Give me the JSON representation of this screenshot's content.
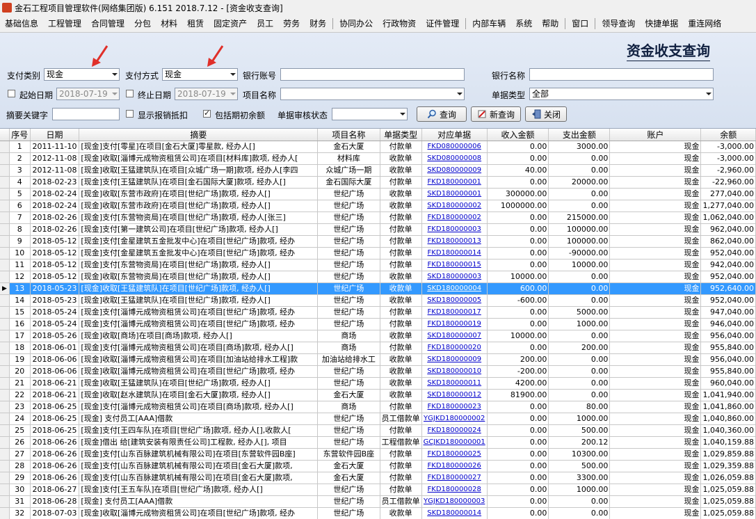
{
  "window": {
    "title": "金石工程项目管理软件(网络集团版) 6.151  2018.7.12 - [资金收支查询]"
  },
  "menu": [
    "基础信息",
    "工程管理",
    "合同管理",
    "分包",
    "材料",
    "租赁",
    "固定资产",
    "员工",
    "劳务",
    "财务",
    "协同办公",
    "行政物资",
    "证件管理",
    "内部车辆",
    "系统",
    "帮助",
    "窗口",
    "领导查询",
    "快捷单据",
    "重连网络"
  ],
  "page": {
    "title": "资金收支查询"
  },
  "filters": {
    "pay_category_label": "支付类别",
    "pay_category_value": "现金",
    "pay_method_label": "支付方式",
    "pay_method_value": "现金",
    "bank_account_label": "银行账号",
    "bank_account_value": "",
    "bank_name_label": "银行名称",
    "bank_name_value": "",
    "start_date_label": "起始日期",
    "start_date_value": "2018-07-19",
    "end_date_label": "终止日期",
    "end_date_value": "2018-07-19",
    "project_name_label": "项目名称",
    "project_name_value": "",
    "doc_type_label": "单据类型",
    "doc_type_value": "全部",
    "keyword_label": "摘要关键字",
    "keyword_value": "",
    "show_reimburse_label": "显示报销抵扣",
    "include_opening_label": "包括期初余额",
    "audit_status_label": "单据审核状态",
    "audit_status_value": ""
  },
  "buttons": {
    "query": "查询",
    "new_query": "新查询",
    "close": "关闭"
  },
  "colors": {
    "accent": "#3399ff",
    "link": "#0000cc",
    "arrow": "#e0302a"
  },
  "table": {
    "headers": [
      "序号",
      "日期",
      "摘要",
      "项目名称",
      "单据类型",
      "对应单据",
      "收入金额",
      "支出金额",
      "账户",
      "余额"
    ],
    "selected_row": 12,
    "rows": [
      [
        "1",
        "2011-11-10",
        "[现金]支付[零星]在项目[金石大厦]零星款, 经办人[]",
        "金石大厦",
        "付款单",
        "FKD080000006",
        "0.00",
        "3000.00",
        "现金",
        "-3,000.00"
      ],
      [
        "2",
        "2012-11-08",
        "[现金]收取[淄博元成物资租赁公司]在项目[材料库]款项, 经办人[",
        "材料库",
        "收款单",
        "SKD080000008",
        "0.00",
        "0.00",
        "现金",
        "-3,000.00"
      ],
      [
        "3",
        "2012-11-08",
        "[现金]收取[王猛建筑队]在项目[众城广场一期]款项, 经办人[李四",
        "众城广场一期",
        "收款单",
        "SKD080000009",
        "40.00",
        "0.00",
        "现金",
        "-2,960.00"
      ],
      [
        "4",
        "2018-02-23",
        "[现金]支付[王猛建筑队]在项目[金石国际大厦]款项, 经办人[]",
        "金石国际大厦",
        "付款单",
        "FKD180000001",
        "0.00",
        "20000.00",
        "现金",
        "-22,960.00"
      ],
      [
        "5",
        "2018-02-24",
        "[现金]收取[东营市政府]在项目[世纪广场]款项, 经办人[]",
        "世纪广场",
        "收款单",
        "SKD180000001",
        "300000.00",
        "0.00",
        "现金",
        "277,040.00"
      ],
      [
        "6",
        "2018-02-24",
        "[现金]收取[东营市政府]在项目[世纪广场]款项, 经办人[]",
        "世纪广场",
        "收款单",
        "SKD180000002",
        "1000000.00",
        "0.00",
        "现金",
        "1,277,040.00"
      ],
      [
        "7",
        "2018-02-26",
        "[现金]支付[东营物资局]在项目[世纪广场]款项, 经办人[张三]",
        "世纪广场",
        "付款单",
        "FKD180000002",
        "0.00",
        "215000.00",
        "现金",
        "1,062,040.00"
      ],
      [
        "8",
        "2018-02-26",
        "[现金]支付[第一建筑公司]在项目[世纪广场]款项, 经办人[]",
        "世纪广场",
        "付款单",
        "FKD180000003",
        "0.00",
        "100000.00",
        "现金",
        "962,040.00"
      ],
      [
        "9",
        "2018-05-12",
        "[现金]支付[金星建筑五金批发中心]在项目[世纪广场]款项, 经办",
        "世纪广场",
        "付款单",
        "FKD180000013",
        "0.00",
        "100000.00",
        "现金",
        "862,040.00"
      ],
      [
        "10",
        "2018-05-12",
        "[现金]支付[金星建筑五金批发中心]在项目[世纪广场]款项, 经办",
        "世纪广场",
        "付款单",
        "FKD180000014",
        "0.00",
        "-90000.00",
        "现金",
        "952,040.00"
      ],
      [
        "11",
        "2018-05-12",
        "[现金]支付[东营物资局]在项目[世纪广场]款项, 经办人[]",
        "世纪广场",
        "付款单",
        "FKD180000015",
        "0.00",
        "10000.00",
        "现金",
        "942,040.00"
      ],
      [
        "12",
        "2018-05-12",
        "[现金]收取[东营物资局]在项目[世纪广场]款项, 经办人[]",
        "世纪广场",
        "收款单",
        "SKD180000003",
        "10000.00",
        "0.00",
        "现金",
        "952,040.00"
      ],
      [
        "13",
        "2018-05-23",
        "[现金]收取[王猛建筑队]在项目[世纪广场]款项, 经办人[]",
        "世纪广场",
        "收款单",
        "SKD180000004",
        "600.00",
        "0.00",
        "现金",
        "952,640.00"
      ],
      [
        "14",
        "2018-05-23",
        "[现金]收取[王猛建筑队]在项目[世纪广场]款项, 经办人[]",
        "世纪广场",
        "收款单",
        "SKD180000005",
        "-600.00",
        "0.00",
        "现金",
        "952,040.00"
      ],
      [
        "15",
        "2018-05-24",
        "[现金]支付[淄博元成物资租赁公司]在项目[世纪广场]款项, 经办",
        "世纪广场",
        "付款单",
        "FKD180000017",
        "0.00",
        "5000.00",
        "现金",
        "947,040.00"
      ],
      [
        "16",
        "2018-05-24",
        "[现金]支付[淄博元成物资租赁公司]在项目[世纪广场]款项, 经办",
        "世纪广场",
        "付款单",
        "FKD180000019",
        "0.00",
        "1000.00",
        "现金",
        "946,040.00"
      ],
      [
        "17",
        "2018-05-26",
        "[现金]收取[商场]在项目[商场]款项, 经办人[]",
        "商场",
        "收款单",
        "SKD180000007",
        "10000.00",
        "0.00",
        "现金",
        "956,040.00"
      ],
      [
        "18",
        "2018-06-01",
        "[现金]支付[淄博元成物资租赁公司]在项目[商场]款项, 经办人[]",
        "商场",
        "付款单",
        "FKD180000020",
        "0.00",
        "200.00",
        "现金",
        "955,840.00"
      ],
      [
        "19",
        "2018-06-06",
        "[现金]收取[淄博元成物资租赁公司]在项目[加油站给排水工程]款",
        "加油站给排水工",
        "收款单",
        "SKD180000009",
        "200.00",
        "0.00",
        "现金",
        "956,040.00"
      ],
      [
        "20",
        "2018-06-06",
        "[现金]收取[淄博元成物资租赁公司]在项目[世纪广场]款项, 经办",
        "世纪广场",
        "收款单",
        "SKD180000010",
        "-200.00",
        "0.00",
        "现金",
        "955,840.00"
      ],
      [
        "21",
        "2018-06-21",
        "[现金]收取[王猛建筑队]在项目[世纪广场]款项, 经办人[]",
        "世纪广场",
        "收款单",
        "SKD180000011",
        "4200.00",
        "0.00",
        "现金",
        "960,040.00"
      ],
      [
        "22",
        "2018-06-21",
        "[现金]收取[赵水建筑队]在项目[金石大厦]款项, 经办人[]",
        "金石大厦",
        "收款单",
        "SKD180000012",
        "81900.00",
        "0.00",
        "现金",
        "1,041,940.00"
      ],
      [
        "23",
        "2018-06-25",
        "[现金]支付[淄博元成物资租赁公司]在项目[商场]款项, 经办人[]",
        "商场",
        "付款单",
        "FKD180000023",
        "0.00",
        "80.00",
        "现金",
        "1,041,860.00"
      ],
      [
        "24",
        "2018-06-25",
        "[现金] 支付员工[AAA]借款",
        "世纪广场",
        "员工借款单",
        "YGJKD180000002",
        "0.00",
        "1000.00",
        "现金",
        "1,040,860.00"
      ],
      [
        "25",
        "2018-06-25",
        "[现金]支付[王四车队]在项目[世纪广场]款项, 经办人[],收款人[",
        "世纪广场",
        "付款单",
        "FKD180000024",
        "0.00",
        "500.00",
        "现金",
        "1,040,360.00"
      ],
      [
        "26",
        "2018-06-26",
        "[现金]借出 给[建筑安装有限责任公司]工程款, 经办人[], 项目",
        "世纪广场",
        "工程借款单",
        "GCJKD180000001",
        "0.00",
        "200.12",
        "现金",
        "1,040,159.88"
      ],
      [
        "27",
        "2018-06-26",
        "[现金]支付[山东百脉建筑机械有限公司]在项目[东营软件园B座]",
        "东营软件园B座",
        "付款单",
        "FKD180000025",
        "0.00",
        "10300.00",
        "现金",
        "1,029,859.88"
      ],
      [
        "28",
        "2018-06-26",
        "[现金]支付[山东百脉建筑机械有限公司]在项目[金石大厦]款项,",
        "金石大厦",
        "付款单",
        "FKD180000026",
        "0.00",
        "500.00",
        "现金",
        "1,029,359.88"
      ],
      [
        "29",
        "2018-06-26",
        "[现金]支付[山东百脉建筑机械有限公司]在项目[金石大厦]款项,",
        "金石大厦",
        "付款单",
        "FKD180000027",
        "0.00",
        "3300.00",
        "现金",
        "1,026,059.88"
      ],
      [
        "30",
        "2018-06-27",
        "[现金]支付[王五车队]在项目[世纪广场]款项, 经办人[]",
        "世纪广场",
        "付款单",
        "FKD180000028",
        "0.00",
        "1000.00",
        "现金",
        "1,025,059.88"
      ],
      [
        "31",
        "2018-06-28",
        "[现金] 支付员工[AAA]借款",
        "世纪广场",
        "员工借款单",
        "YGJKD180000003",
        "0.00",
        "0.00",
        "现金",
        "1,025,059.88"
      ],
      [
        "32",
        "2018-07-03",
        "[现金]收取[淄博元成物资租赁公司]在项目[世纪广场]款项, 经办",
        "世纪广场",
        "收款单",
        "SKD180000014",
        "0.00",
        "0.00",
        "现金",
        "1,025,059.88"
      ]
    ]
  }
}
